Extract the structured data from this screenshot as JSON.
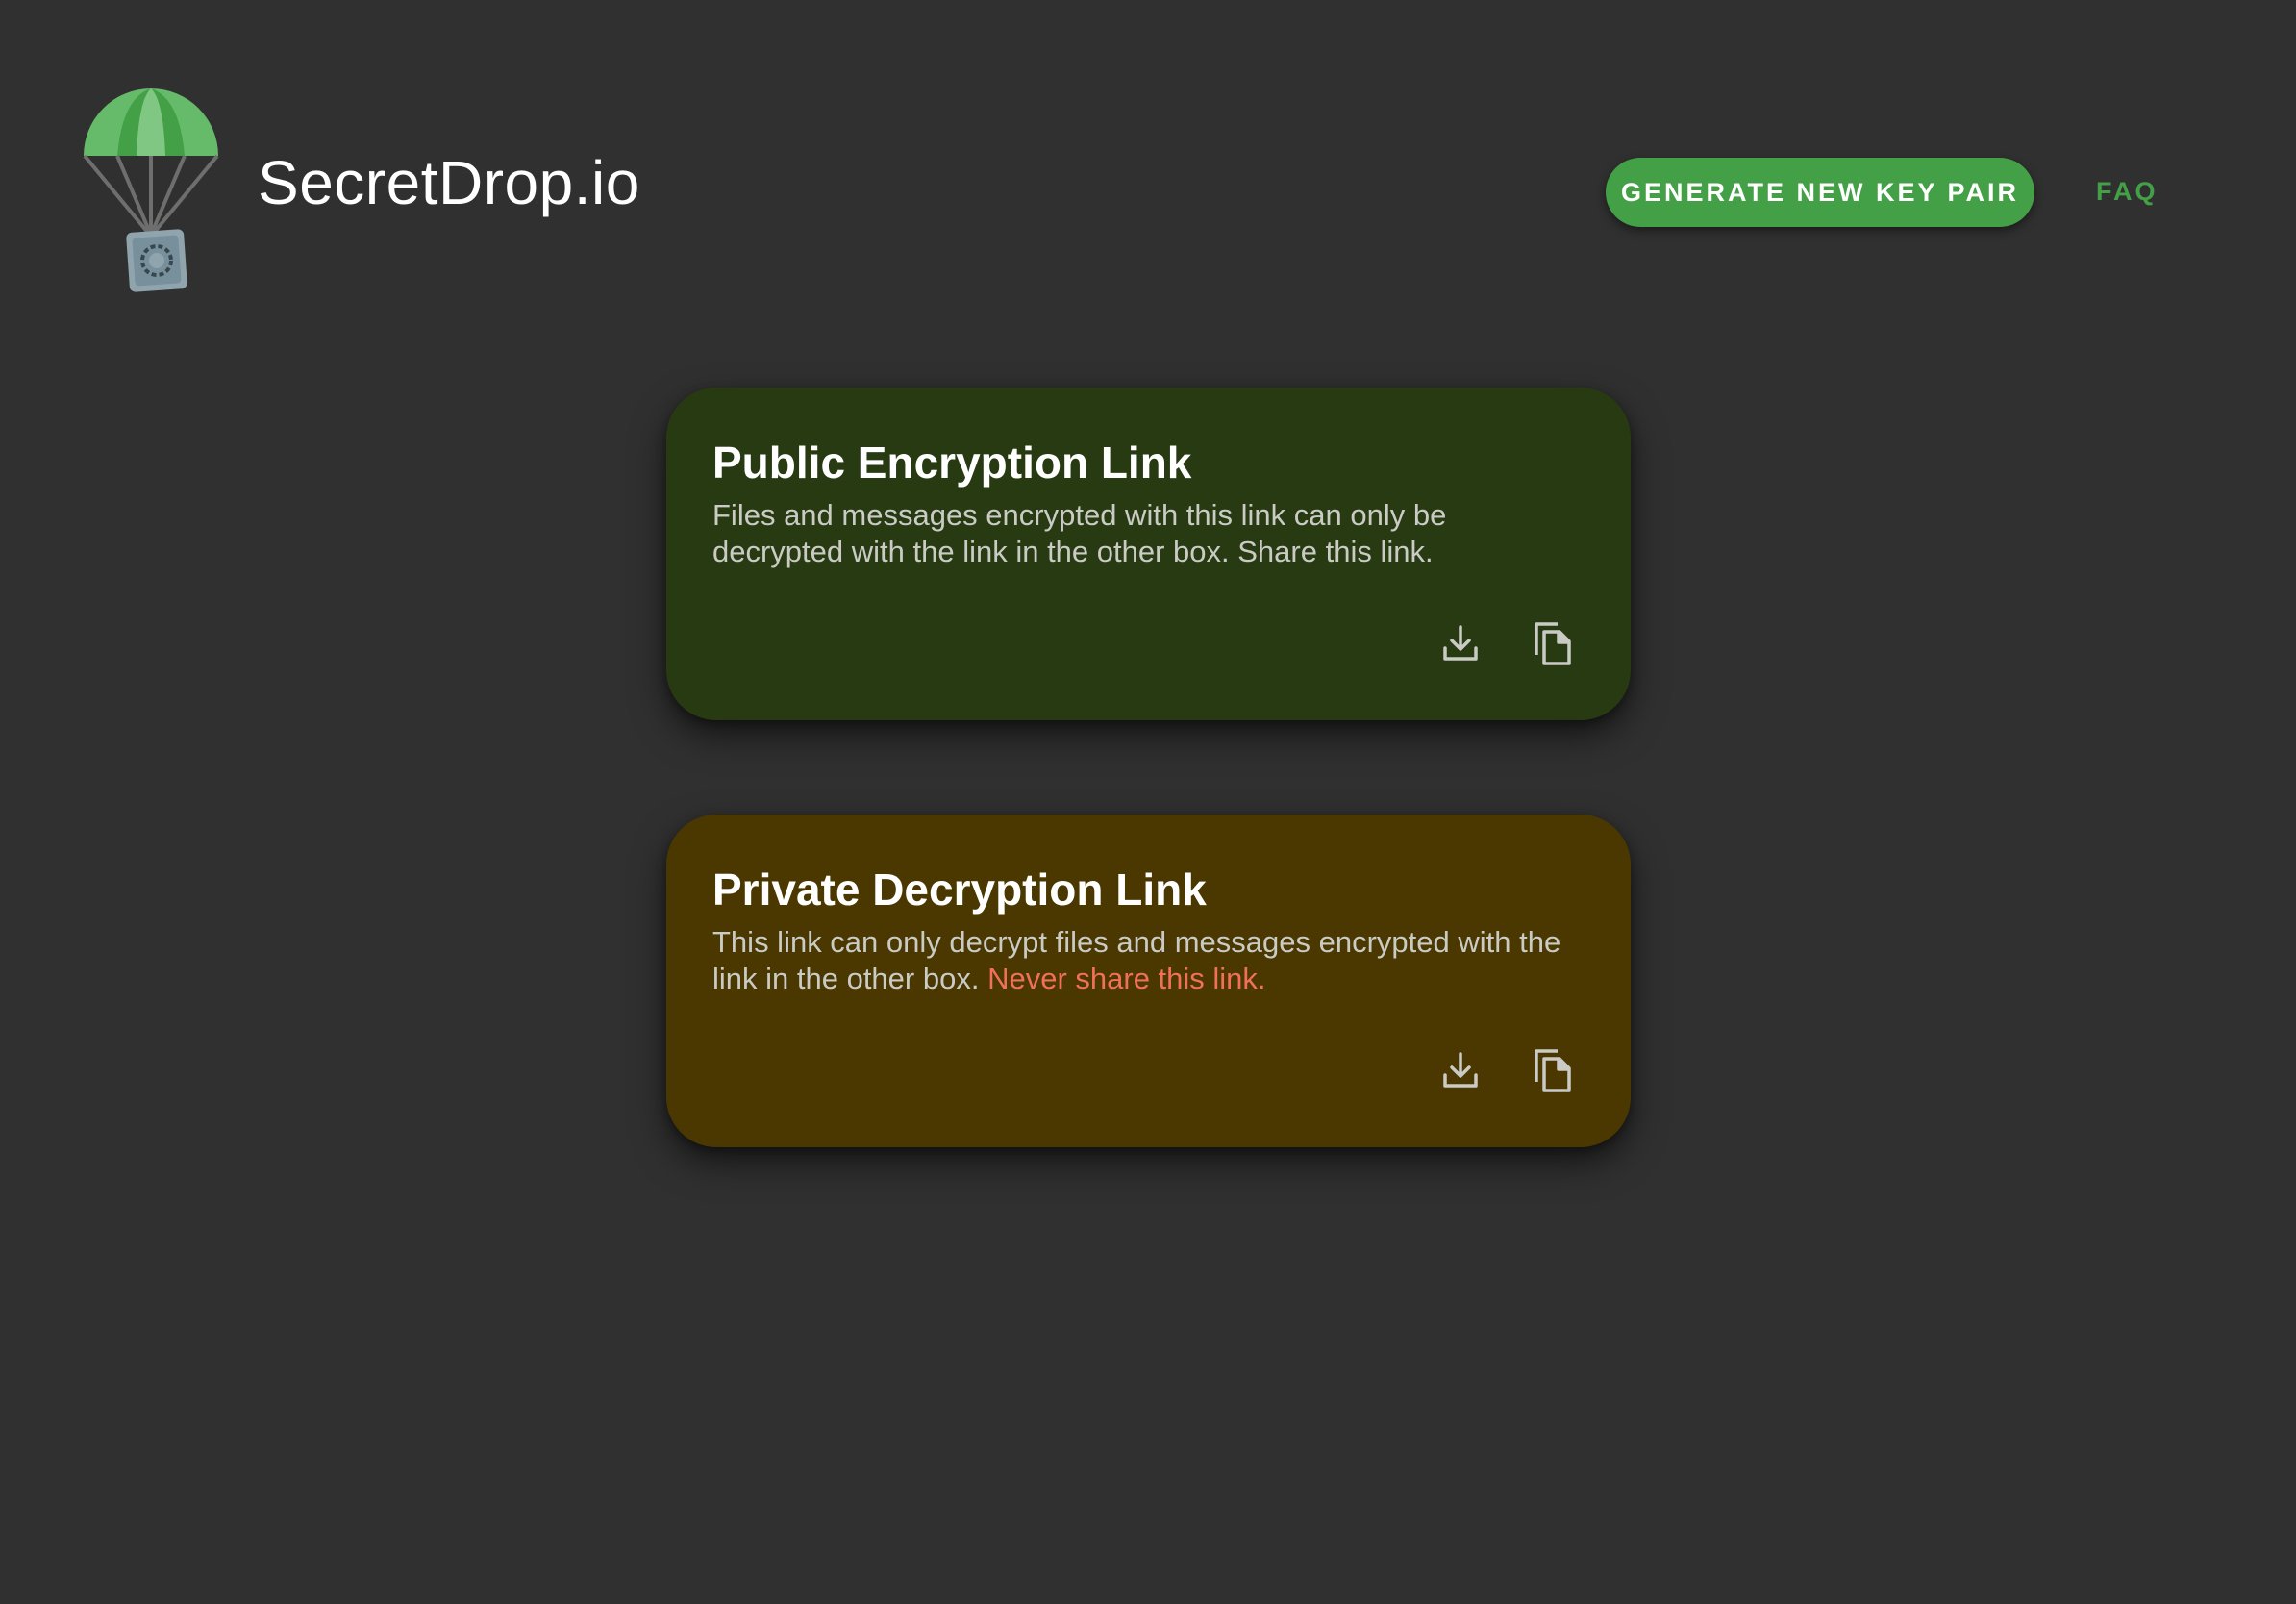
{
  "header": {
    "app_title": "SecretDrop.io",
    "generate_button_label": "GENERATE NEW KEY PAIR",
    "faq_label": "FAQ",
    "logo_icon": "parachute-safe-icon"
  },
  "cards": {
    "public": {
      "title": "Public Encryption Link",
      "description": "Files and messages encrypted with this link can only be decrypted with the link in the other box. Share this link.",
      "download_icon": "download-icon",
      "copy_icon": "copy-icon"
    },
    "private": {
      "title": "Private Decryption Link",
      "description": "This link can only decrypt files and messages encrypted with the link in the other box.",
      "warning": "Never share this link.",
      "download_icon": "download-icon",
      "copy_icon": "copy-icon"
    }
  },
  "colors": {
    "background": "#303030",
    "accent_green": "#43a047",
    "public_card": "#283a12",
    "private_card": "#4a3800",
    "warning_text": "#f0705a"
  }
}
